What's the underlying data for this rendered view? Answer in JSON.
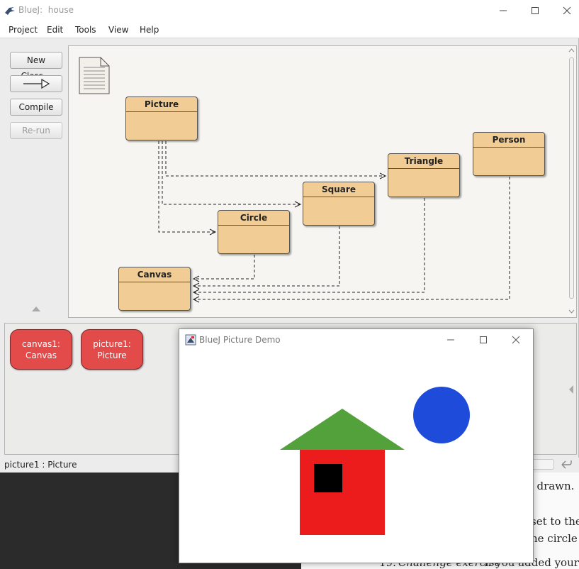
{
  "window": {
    "app_name": "BlueJ:",
    "project_name": "house",
    "controls": {
      "minimize": "—",
      "maximize": "☐",
      "close": "✕"
    }
  },
  "menu": [
    "Project",
    "Edit",
    "Tools",
    "View",
    "Help"
  ],
  "toolbar": {
    "new_class": "New Class...",
    "compile": "Compile",
    "rerun": "Re-run"
  },
  "diagram": {
    "classes": [
      {
        "name": "Picture"
      },
      {
        "name": "Person"
      },
      {
        "name": "Triangle"
      },
      {
        "name": "Square"
      },
      {
        "name": "Circle"
      },
      {
        "name": "Canvas"
      }
    ]
  },
  "object_bench": {
    "objects": [
      {
        "name": "canvas1:",
        "type": "Canvas"
      },
      {
        "name": "picture1:",
        "type": "Picture"
      }
    ]
  },
  "status": "picture1 : Picture",
  "demo_window": {
    "title": "BlueJ Picture Demo",
    "colors": {
      "wall": "#ec1c1c",
      "window": "#000000",
      "roof": "#52a13a",
      "sun": "#1f4bdb"
    }
  },
  "background_doc": {
    "lines": [
      "s drawn.",
      "set to the",
      "he circle h",
      "19.",
      "Challenge exercise",
      "If you added your su"
    ]
  }
}
